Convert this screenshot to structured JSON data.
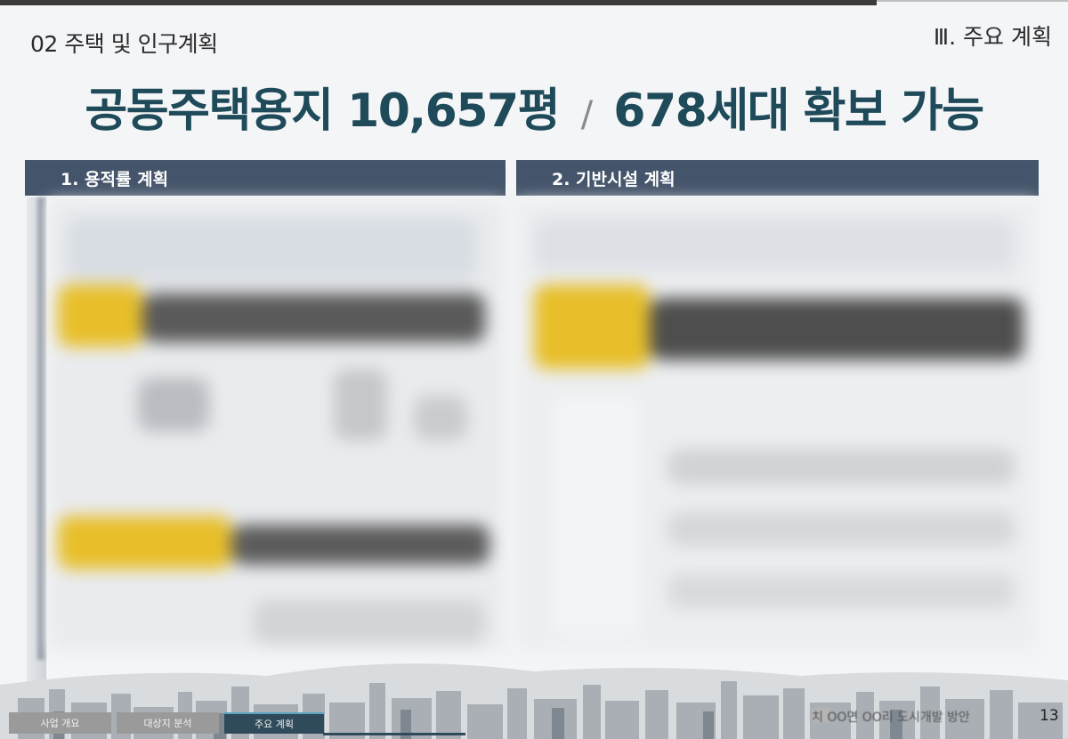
{
  "header": {
    "section_title": "02 주택 및 인구계획",
    "chapter": "Ⅲ. 주요 계획",
    "headline_part1": "공동주택용지 10,657평",
    "headline_sep": "/",
    "headline_part2": "678세대 확보 가능"
  },
  "panels": [
    {
      "title": "1. 용적률 계획"
    },
    {
      "title": "2. 기반시설 계획"
    }
  ],
  "footer": {
    "tabs": [
      "사업 개요",
      "대상지 분석",
      "주요 계획"
    ],
    "note": "치 OO면 OO리 도시개발 방안",
    "page": "13"
  },
  "colors": {
    "headline": "#1e4a59",
    "panel_header": "#44546a",
    "accent_yellow": "#e8bf2a",
    "active_tab": "#2f4a5a"
  }
}
